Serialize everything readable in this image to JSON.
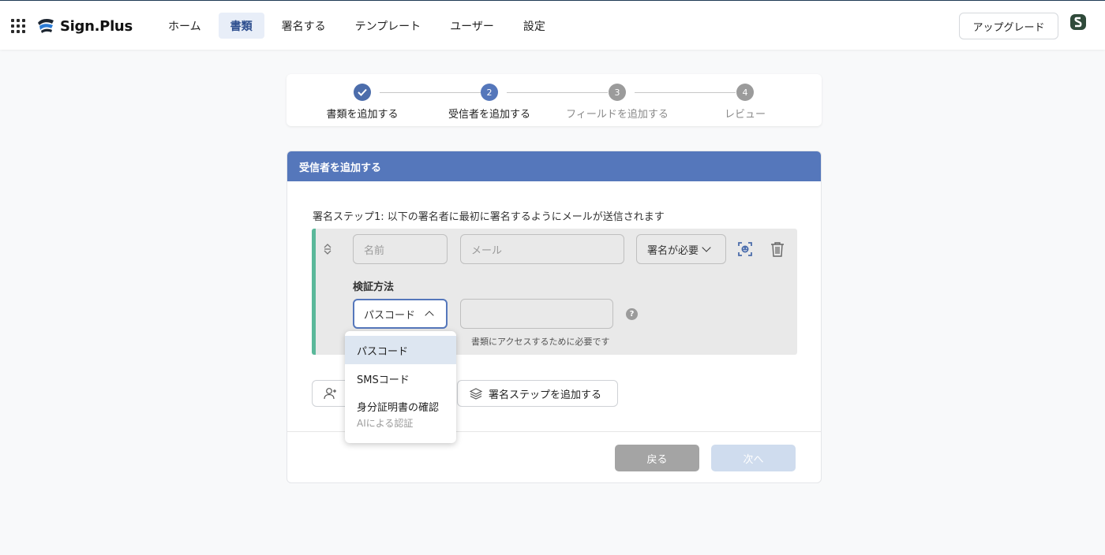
{
  "header": {
    "logo_text": "Sign.Plus",
    "nav": [
      {
        "label": "ホーム",
        "active": false
      },
      {
        "label": "書類",
        "active": true
      },
      {
        "label": "署名する",
        "active": false
      },
      {
        "label": "テンプレート",
        "active": false
      },
      {
        "label": "ユーザー",
        "active": false
      },
      {
        "label": "設定",
        "active": false
      }
    ],
    "upgrade_label": "アップグレード"
  },
  "stepper": {
    "steps": [
      {
        "number": "",
        "label": "書類を追加する",
        "state": "done"
      },
      {
        "number": "2",
        "label": "受信者を追加する",
        "state": "current"
      },
      {
        "number": "3",
        "label": "フィールドを追加する",
        "state": "todo"
      },
      {
        "number": "4",
        "label": "レビュー",
        "state": "todo"
      }
    ]
  },
  "card": {
    "title": "受信者を追加する",
    "step_description": "署名ステップ1: 以下の署名者に最初に署名するようにメールが送信されます",
    "name_placeholder": "名前",
    "email_placeholder": "メール",
    "sign_requirement": "署名が必要",
    "verification_label": "検証方法",
    "verification_value": "パスコード",
    "passcode_help": "?",
    "passcode_helper_text": "書類にアクセスするために必要です",
    "add_recipient_label": "+ ",
    "add_step_label": "署名ステップを追加する",
    "back_label": "戻る",
    "next_label": "次へ"
  },
  "dropdown": {
    "options": [
      {
        "label": "パスコード",
        "sub": ""
      },
      {
        "label": "SMSコード",
        "sub": ""
      },
      {
        "label": "身分証明書の確認",
        "sub": "AIによる認証"
      }
    ]
  },
  "colors": {
    "primary": "#5577bb",
    "accent_green": "#5ab89a",
    "nav_active_bg": "#e8eef8"
  }
}
